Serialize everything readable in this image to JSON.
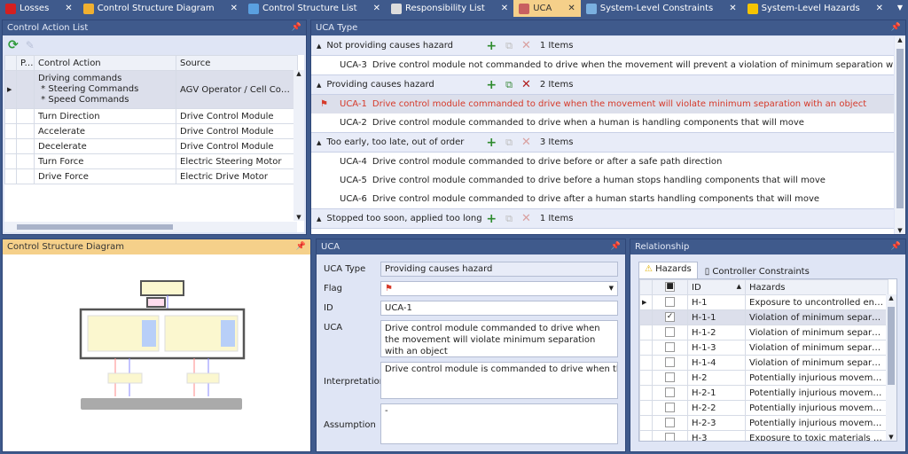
{
  "tabs": [
    {
      "label": "Losses",
      "icon": "error-icon",
      "color": "#d42020"
    },
    {
      "label": "Control Structure Diagram",
      "icon": "diagram-icon",
      "color": "#f0b030"
    },
    {
      "label": "Control Structure List",
      "icon": "list-icon",
      "color": "#5aa0e0"
    },
    {
      "label": "Responsibility List",
      "icon": "clipboard-icon",
      "color": "#ddd"
    },
    {
      "label": "UCA",
      "icon": "uca-icon",
      "color": "#c86060",
      "active": true
    },
    {
      "label": "System-Level Constraints",
      "icon": "constraint-icon",
      "color": "#7ab0e0"
    },
    {
      "label": "System-Level Hazards",
      "icon": "warning-icon",
      "color": "#f5c400"
    }
  ],
  "close_glyph": "✕",
  "control_action_list": {
    "title": "Control Action List",
    "columns": [
      "P...",
      "Control Action",
      "Source"
    ],
    "rows": [
      {
        "action": "Driving commands\n * Steering Commands\n * Speed Commands",
        "source": "AGV Operator / Cell Controller"
      },
      {
        "action": "Turn Direction",
        "source": "Drive Control Module"
      },
      {
        "action": "Accelerate",
        "source": "Drive Control Module"
      },
      {
        "action": "Decelerate",
        "source": "Drive Control Module"
      },
      {
        "action": "Turn Force",
        "source": "Electric Steering Motor"
      },
      {
        "action": "Drive Force",
        "source": "Electric Drive Motor"
      }
    ]
  },
  "uca_type": {
    "title": "UCA Type",
    "groups": [
      {
        "label": "Not providing causes hazard",
        "count": "1  Items",
        "items": [
          {
            "id": "UCA-3",
            "text": "Drive control module not commanded to drive when the movement will prevent a violation of minimum separation with an object"
          }
        ]
      },
      {
        "label": "Providing causes hazard",
        "count": "2  Items",
        "items": [
          {
            "id": "UCA-1",
            "text": "Drive control module commanded to drive when the movement will violate minimum separation with an object",
            "selected": true
          },
          {
            "id": "UCA-2",
            "text": "Drive control module commanded to drive when a human is handling components that will move"
          }
        ]
      },
      {
        "label": "Too early, too late, out of order",
        "count": "3  Items",
        "items": [
          {
            "id": "UCA-4",
            "text": "Drive control module commanded to drive before or after a safe path direction"
          },
          {
            "id": "UCA-5",
            "text": "Drive control module commanded to drive before a human stops handling components that will move"
          },
          {
            "id": "UCA-6",
            "text": "Drive control module commanded to drive after a human starts handling components that will move"
          }
        ]
      },
      {
        "label": "Stopped too soon, applied too long",
        "count": "1  Items",
        "items": []
      }
    ]
  },
  "diagram": {
    "title": "Control Structure Diagram"
  },
  "uca": {
    "title": "UCA",
    "fields": {
      "type_label": "UCA Type",
      "type": "Providing causes hazard",
      "flag_label": "Flag",
      "id_label": "ID",
      "id": "UCA-1",
      "uca_label": "UCA",
      "uca": "Drive control module commanded to drive when the movement will violate minimum separation with an object",
      "interp_label": "Interpretation",
      "interp": "Drive control module is commanded to drive when the movement will violate minimum separation with an object",
      "assump_label": "Assumption",
      "assump": "-"
    }
  },
  "relationship": {
    "title": "Relationship",
    "tabs": [
      "Hazards",
      "Controller Constraints"
    ],
    "columns": [
      "ID",
      "Hazards"
    ],
    "rows": [
      {
        "id": "H-1",
        "text": "Exposure to uncontrolled energy...",
        "checked": false
      },
      {
        "id": "H-1-1",
        "text": "Violation of minimum separation...",
        "checked": true
      },
      {
        "id": "H-1-2",
        "text": "Violation of minimum separation...",
        "checked": false
      },
      {
        "id": "H-1-3",
        "text": "Violation of minimum separation...",
        "checked": false
      },
      {
        "id": "H-1-4",
        "text": "Violation of minimum separation...",
        "checked": false
      },
      {
        "id": "H-2",
        "text": "Potentially injurious movement o...",
        "checked": false
      },
      {
        "id": "H-2-1",
        "text": "Potentially injurious movement o...",
        "checked": false
      },
      {
        "id": "H-2-2",
        "text": "Potentially injurious movement o...",
        "checked": false
      },
      {
        "id": "H-2-3",
        "text": "Potentially injurious movement o...",
        "checked": false
      },
      {
        "id": "H-3",
        "text": "Exposure to toxic materials abov...",
        "checked": false
      }
    ]
  }
}
